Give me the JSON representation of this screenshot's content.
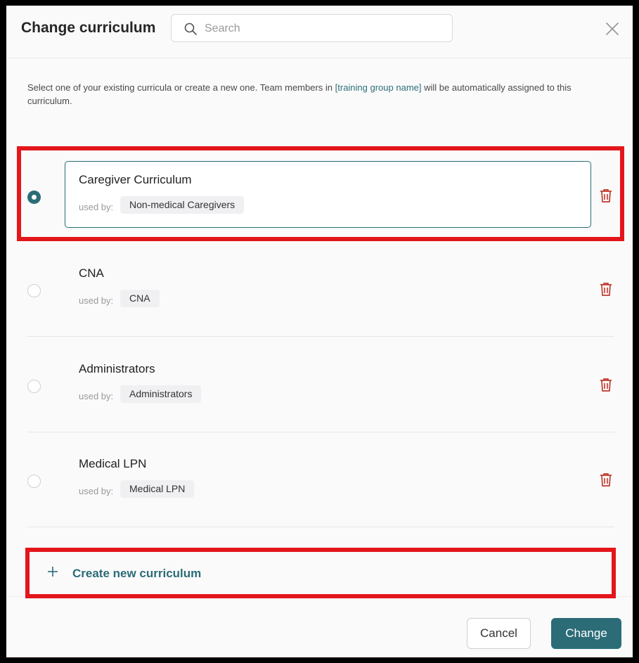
{
  "header": {
    "title": "Change curriculum",
    "search_placeholder": "Search",
    "search_value": ""
  },
  "description": {
    "before": "Select one of your existing curricula or create a new one. Team members in ",
    "link": "[training group name]",
    "after": " will be automatically assigned to this curriculum."
  },
  "curricula": [
    {
      "name": "Caregiver Curriculum",
      "used_by_label": "used by:",
      "used_by": "Non-medical Caregivers",
      "selected": true
    },
    {
      "name": "CNA",
      "used_by_label": "used by:",
      "used_by": "CNA",
      "selected": false
    },
    {
      "name": "Administrators",
      "used_by_label": "used by:",
      "used_by": "Administrators",
      "selected": false
    },
    {
      "name": "Medical LPN",
      "used_by_label": "used by:",
      "used_by": "Medical LPN",
      "selected": false
    }
  ],
  "create_new_label": "Create new curriculum",
  "footer": {
    "cancel_label": "Cancel",
    "change_label": "Change"
  },
  "colors": {
    "accent": "#2b6c77",
    "delete": "#c0392b",
    "highlight": "#e3161b"
  },
  "icons": {
    "search": "search-icon",
    "close": "close-icon",
    "delete": "trash-icon",
    "create": "plus-icon"
  }
}
